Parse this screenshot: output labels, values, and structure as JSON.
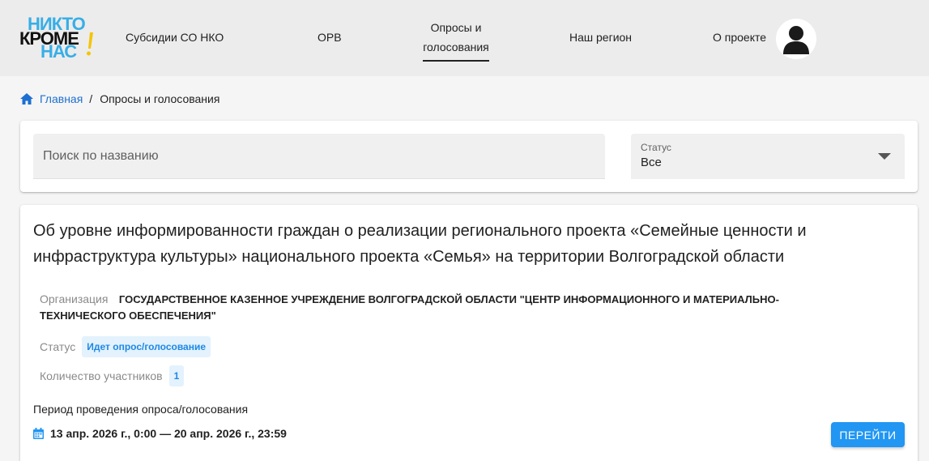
{
  "logo": {
    "line1": "НИКТО",
    "line2": "КРОМЕ",
    "line3": "НАС",
    "accent_color": "#38aee6",
    "exclamation_color": "#f5c400"
  },
  "nav": {
    "items": [
      {
        "label": "Субсидии СО НКО"
      },
      {
        "label": "ОРВ"
      },
      {
        "label_line1": "Опросы и",
        "label_line2": "голосования",
        "active": true
      },
      {
        "label": "Наш регион"
      },
      {
        "label": "О проекте"
      }
    ]
  },
  "breadcrumb": {
    "home": "Главная",
    "separator": "/",
    "current": "Опросы и голосования"
  },
  "filters": {
    "search_placeholder": "Поиск по названию",
    "status_label": "Статус",
    "status_value": "Все"
  },
  "survey": {
    "title": "Об уровне информированности граждан о реализации регионального проекта «Семейные ценности и инфраструктура культуры» национального проекта «Семья» на территории Волгоградской области",
    "org_label": "Организация",
    "org_value": "ГОСУДАРСТВЕННОЕ КАЗЕННОЕ УЧРЕЖДЕНИЕ ВОЛГОГРАДСКОЙ ОБЛАСТИ \"ЦЕНТР ИНФОРМАЦИОННОГО И МАТЕРИАЛЬНО-ТЕХНИЧЕСКОГО ОБЕСПЕЧЕНИЯ\"",
    "status_label": "Статус",
    "status_value": "Идет опрос/голосование",
    "participants_label": "Количество участников",
    "participants_value": "1",
    "period_label": "Период проведения опроса/голосования",
    "period_value": "13 апр. 2026 г., 0:00 — 20 апр. 2026 г., 23:59",
    "button_label": "ПЕРЕЙТИ"
  },
  "colors": {
    "primary": "#2196f3",
    "link": "#1e6fd1",
    "badge_bg": "#e3f2fd",
    "header_bg": "#ececec"
  },
  "icons": [
    "home-icon",
    "chevron-down-icon",
    "calendar-icon",
    "user-avatar-icon"
  ]
}
